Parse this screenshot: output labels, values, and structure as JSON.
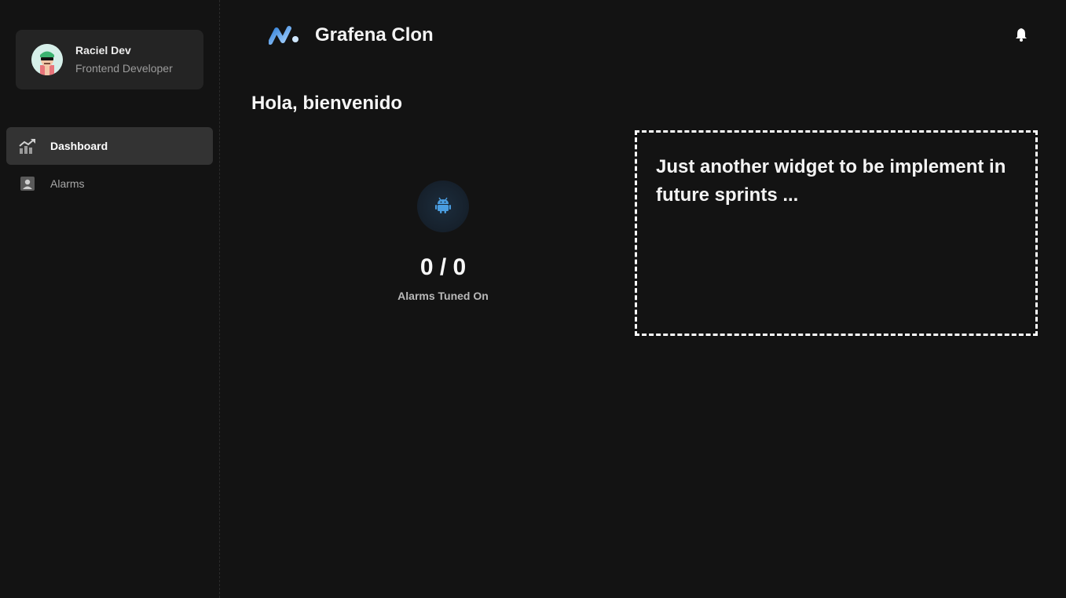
{
  "user": {
    "name": "Raciel Dev",
    "role": "Frontend Developer"
  },
  "nav": {
    "items": [
      {
        "label": "Dashboard",
        "icon": "chart-trend-icon",
        "active": true
      },
      {
        "label": "Alarms",
        "icon": "user-square-icon",
        "active": false
      }
    ]
  },
  "header": {
    "app_name": "Grafena Clon",
    "notifications_icon": "bell-icon"
  },
  "main": {
    "greeting": "Hola, bienvenido",
    "stat": {
      "value": "0 / 0",
      "label": "Alarms Tuned On",
      "icon": "android-icon"
    },
    "widget": {
      "text": "Just another widget to be implement in future sprints ..."
    }
  },
  "colors": {
    "background": "#131313",
    "card": "#242424",
    "active_nav": "#333333",
    "accent_blue": "#4a9de0"
  }
}
